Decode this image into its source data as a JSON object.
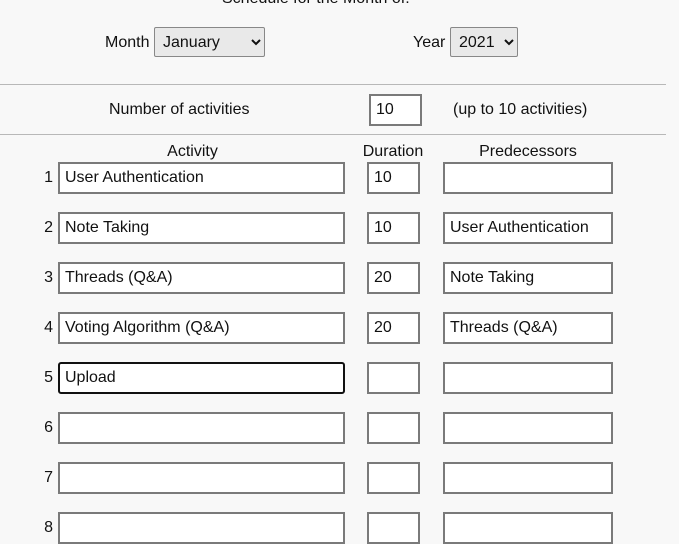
{
  "header": {
    "title": "Schedule for the Month of:",
    "month_label": "Month",
    "month_value": "January",
    "year_label": "Year",
    "year_value": "2021"
  },
  "activities_count": {
    "label": "Number of activities",
    "value": "10",
    "hint": "(up to 10 activities)"
  },
  "columns": {
    "activity": "Activity",
    "duration": "Duration",
    "predecessors": "Predecessors"
  },
  "rows": [
    {
      "num": "1",
      "activity": "User Authentication",
      "duration": "10",
      "predecessors": ""
    },
    {
      "num": "2",
      "activity": "Note Taking",
      "duration": "10",
      "predecessors": "User Authentication"
    },
    {
      "num": "3",
      "activity": "Threads (Q&A)",
      "duration": "20",
      "predecessors": "Note Taking"
    },
    {
      "num": "4",
      "activity": "Voting Algorithm (Q&A)",
      "duration": "20",
      "predecessors": "Threads (Q&A)"
    },
    {
      "num": "5",
      "activity": "Upload",
      "duration": "",
      "predecessors": ""
    },
    {
      "num": "6",
      "activity": "",
      "duration": "",
      "predecessors": ""
    },
    {
      "num": "7",
      "activity": "",
      "duration": "",
      "predecessors": ""
    },
    {
      "num": "8",
      "activity": "",
      "duration": "",
      "predecessors": ""
    }
  ]
}
